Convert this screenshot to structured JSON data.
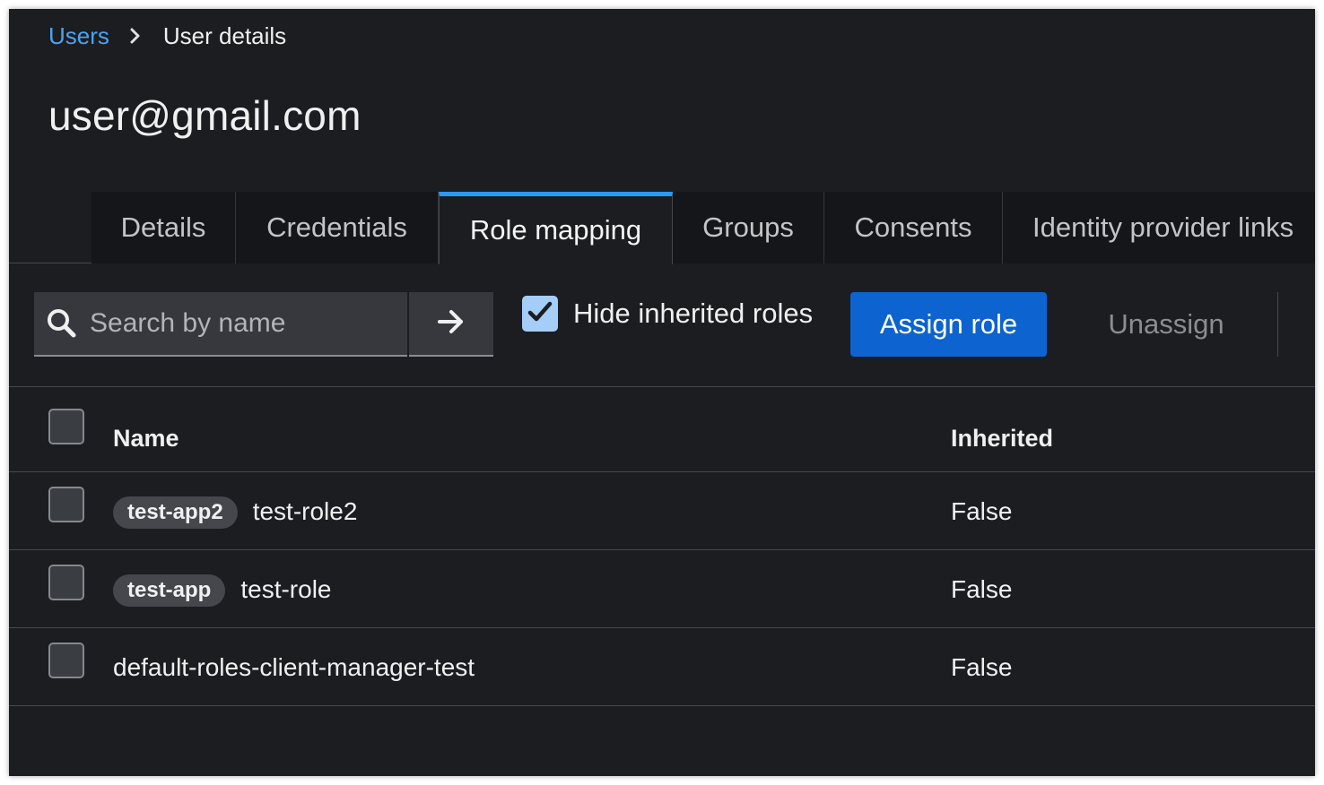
{
  "breadcrumb": {
    "parent": "Users",
    "current": "User details"
  },
  "page_title": "user@gmail.com",
  "tabs": [
    {
      "label": "Details",
      "active": false
    },
    {
      "label": "Credentials",
      "active": false
    },
    {
      "label": "Role mapping",
      "active": true
    },
    {
      "label": "Groups",
      "active": false
    },
    {
      "label": "Consents",
      "active": false
    },
    {
      "label": "Identity provider links",
      "active": false
    }
  ],
  "toolbar": {
    "search_placeholder": "Search by name",
    "search_value": "",
    "hide_inherited_label": "Hide inherited roles",
    "hide_inherited_checked": true,
    "assign_label": "Assign role",
    "unassign_label": "Unassign"
  },
  "table": {
    "columns": [
      "Name",
      "Inherited"
    ],
    "rows": [
      {
        "client": "test-app2",
        "role": "test-role2",
        "inherited": "False"
      },
      {
        "client": "test-app",
        "role": "test-role",
        "inherited": "False"
      },
      {
        "client": "",
        "role": "default-roles-client-manager-test",
        "inherited": "False"
      }
    ]
  },
  "colors": {
    "background": "#1b1d21",
    "link": "#4ea2f0",
    "primary_button": "#0d63cf",
    "active_tab_indicator": "#2b9af3",
    "checkbox_checked": "#a4cdf7"
  },
  "icons": {
    "breadcrumb_separator": "chevron-right-icon",
    "search": "search-icon",
    "search_submit": "arrow-right-icon",
    "checkbox": "check-icon"
  }
}
